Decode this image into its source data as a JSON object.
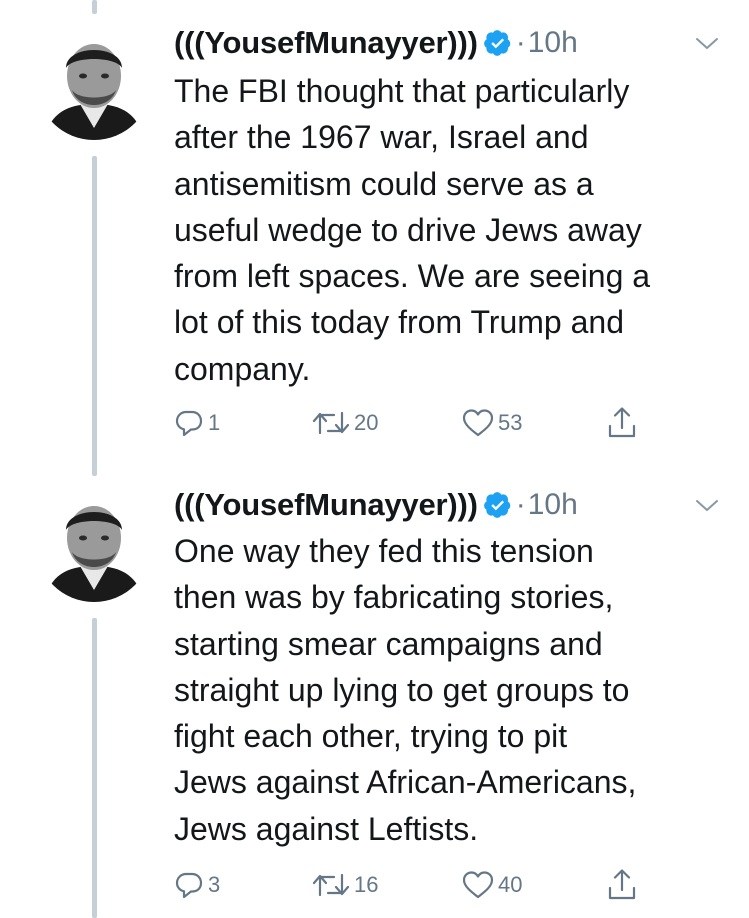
{
  "tweets": [
    {
      "display_name": "(((YousefMunayyer)))",
      "dot": "·",
      "time": "10h",
      "lines": [
        "The FBI thought that particularly",
        "after the 1967 war, Israel and",
        "antisemitism could serve as a",
        "useful wedge to drive Jews away",
        "from left spaces. We are seeing a",
        "lot of this today from Trump and",
        "company."
      ],
      "replies": "1",
      "retweets": "20",
      "likes": "53"
    },
    {
      "display_name": "(((YousefMunayyer)))",
      "dot": "·",
      "time": "10h",
      "lines": [
        "One way they fed this tension",
        "then was by fabricating stories,",
        "starting smear campaigns and",
        "straight up lying to get groups to",
        "fight each other, trying to pit",
        "Jews against African-Americans,",
        "Jews against Leftists."
      ],
      "replies": "3",
      "retweets": "16",
      "likes": "40"
    }
  ],
  "colors": {
    "verified": "#1da1f2",
    "secondary_text": "#657786",
    "thread_line": "#c4cfd6"
  },
  "icons": [
    "reply-icon",
    "retweet-icon",
    "like-icon",
    "share-icon",
    "verified-badge-icon",
    "chevron-down-icon"
  ]
}
